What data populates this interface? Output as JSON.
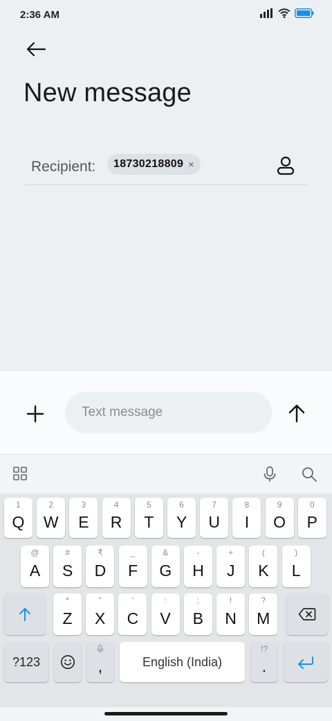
{
  "status_bar": {
    "time": "2:36 AM",
    "icons": [
      "signal-icon",
      "wifi-icon",
      "battery-icon"
    ]
  },
  "header": {
    "back_icon": "arrow-left-icon",
    "title": "New message"
  },
  "recipient": {
    "label": "Recipient:",
    "chip_value": "18730218809",
    "chip_close": "×",
    "contacts_icon": "person-icon"
  },
  "composer": {
    "attach_icon": "plus-icon",
    "placeholder": "Text message",
    "value": "",
    "send_icon": "arrow-up-icon"
  },
  "keyboard": {
    "toolbar": {
      "left_icon": "grid-icon",
      "right_icons": [
        "mic-icon",
        "search-icon"
      ]
    },
    "row1": [
      {
        "hint": "1",
        "key": "Q"
      },
      {
        "hint": "2",
        "key": "W"
      },
      {
        "hint": "3",
        "key": "E"
      },
      {
        "hint": "4",
        "key": "R"
      },
      {
        "hint": "5",
        "key": "T"
      },
      {
        "hint": "6",
        "key": "Y"
      },
      {
        "hint": "7",
        "key": "U"
      },
      {
        "hint": "8",
        "key": "I"
      },
      {
        "hint": "9",
        "key": "O"
      },
      {
        "hint": "0",
        "key": "P"
      }
    ],
    "row2": [
      {
        "hint": "@",
        "key": "A"
      },
      {
        "hint": "#",
        "key": "S"
      },
      {
        "hint": "₹",
        "key": "D"
      },
      {
        "hint": "_",
        "key": "F"
      },
      {
        "hint": "&",
        "key": "G"
      },
      {
        "hint": "-",
        "key": "H"
      },
      {
        "hint": "+",
        "key": "J"
      },
      {
        "hint": "(",
        "key": "K"
      },
      {
        "hint": ")",
        "key": "L"
      }
    ],
    "row3": [
      {
        "hint": "*",
        "key": "Z"
      },
      {
        "hint": "\"",
        "key": "X"
      },
      {
        "hint": "'",
        "key": "C"
      },
      {
        "hint": ":",
        "key": "V"
      },
      {
        "hint": ";",
        "key": "B"
      },
      {
        "hint": "!",
        "key": "N"
      },
      {
        "hint": "?",
        "key": "M"
      }
    ],
    "shift_icon": "shift-arrow-icon",
    "backspace_icon": "backspace-icon",
    "symbols_label": "?123",
    "emoji_icon": "emoji-icon",
    "comma": ",",
    "comma_hint_icon": "mic-icon",
    "space_label": "English (India)",
    "period": ".",
    "period_hint": "!?",
    "enter_icon": "enter-icon",
    "accent_color": "#1a8fe3"
  }
}
